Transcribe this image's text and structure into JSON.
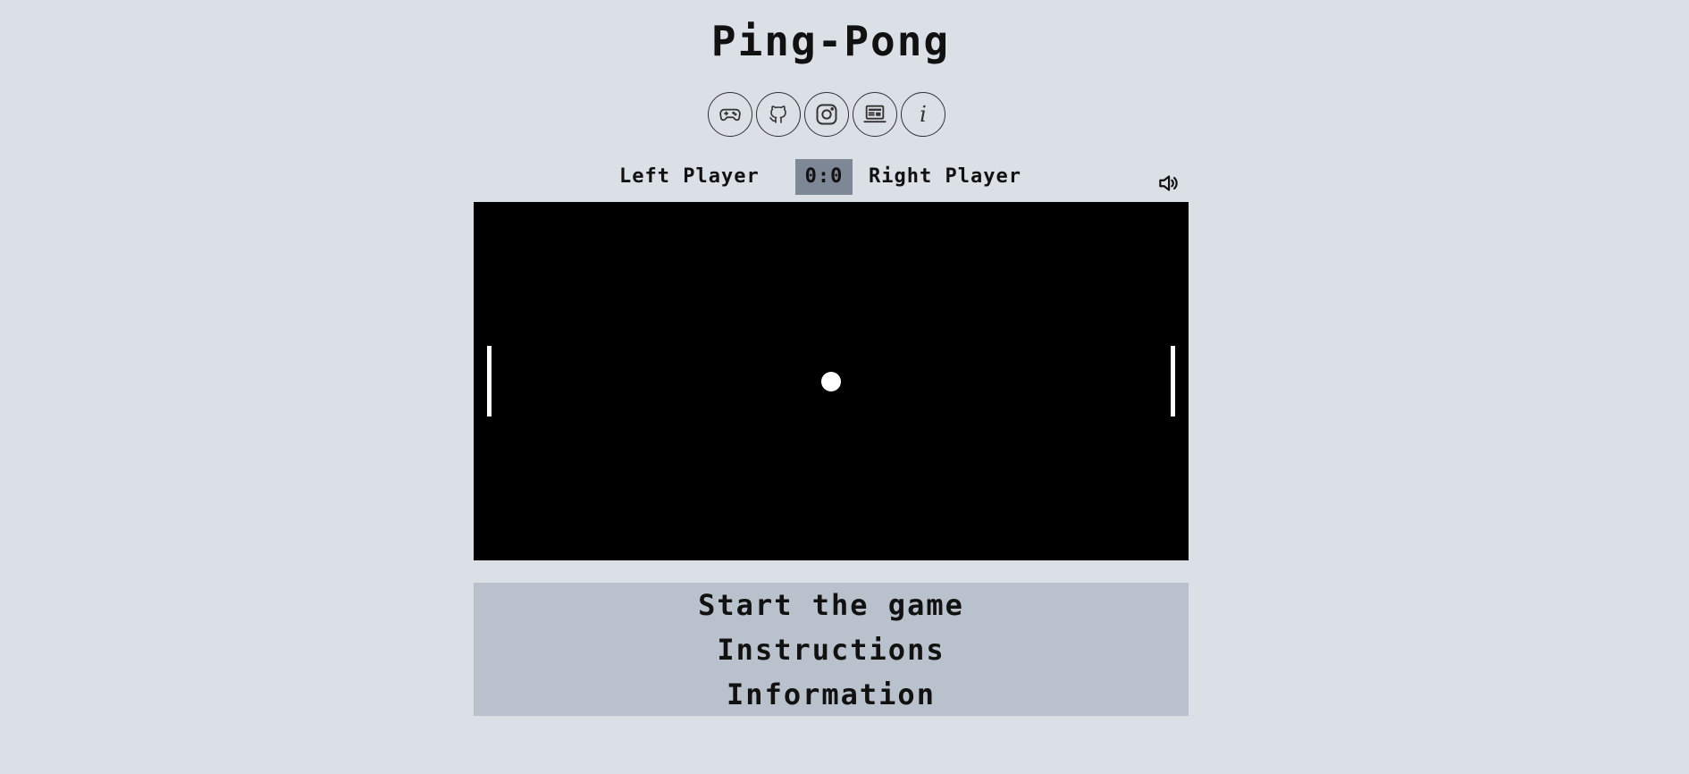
{
  "header": {
    "title": "Ping-Pong",
    "icons": [
      "gamepad-icon",
      "github-icon",
      "instagram-icon",
      "laptop-icon",
      "info-icon"
    ],
    "info_glyph": "i"
  },
  "scoreboard": {
    "left_player": "Left Player",
    "score": "0:0",
    "right_player": "Right Player",
    "sound_icon": "speaker-volume-icon"
  },
  "game": {
    "background": "#000000",
    "paddle_color": "#ffffff",
    "ball_color": "#ffffff"
  },
  "menu": {
    "start_label": "Start the game",
    "instructions_label": "Instructions",
    "information_label": "Information"
  },
  "colors": {
    "page_background": "#dbe0e7",
    "score_background": "#7d8795",
    "menu_background": "#b9c1cc"
  }
}
